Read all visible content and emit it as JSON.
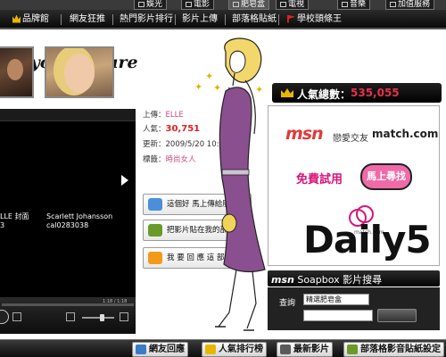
{
  "top_tabs": [
    {
      "label": "娛光"
    },
    {
      "label": "電影"
    },
    {
      "label": "肥皂盒"
    },
    {
      "label": "電視"
    },
    {
      "label": "音樂"
    },
    {
      "label": "加值服務"
    }
  ],
  "nav": {
    "items": [
      {
        "label": "品牌館"
      },
      {
        "label": "網友狂推"
      },
      {
        "label": "熱門影片排行"
      },
      {
        "label": "影片上傳"
      },
      {
        "label": "部落格貼紙"
      },
      {
        "label": "學校頭條王"
      }
    ]
  },
  "tagline": "ng your future",
  "player": {
    "thumbs": [
      {
        "caption1": "LLE 封面",
        "caption2": "3"
      },
      {
        "caption1": "Scarlett Johansson",
        "caption2": "cal0283038"
      }
    ],
    "time": "1:18 / 1:18"
  },
  "info": {
    "uploader_label": "上傳：",
    "uploader": "ELLE",
    "popularity_label": "人氣：",
    "popularity": "30,751",
    "updated_label": "更新：",
    "updated": "2009/5/20 10:49",
    "tags_label": "標籤：",
    "tags": "時尚女人"
  },
  "actions": {
    "share": "這個好 馬上傳給朋友看",
    "blog": "把影片貼在我的部落格",
    "reply": "我 要 回 應 這 部 影 片"
  },
  "panel": {
    "title": "人氣總數：",
    "count": "535,055"
  },
  "ad": {
    "msn_logo": "msn",
    "msn_text": "戀愛交友",
    "match": "match.com",
    "free_trial": "免費試用",
    "find_btn": "馬上尋找",
    "daily5_sub": "match.com",
    "daily5": "Daily5"
  },
  "soapbox": {
    "msn": "msn",
    "title_brand": "Soapbox",
    "title_rest": "影片搜尋",
    "search_label": "查詢",
    "select_value": "精選肥皂盒",
    "input_value": ""
  },
  "bottom": {
    "buttons": [
      {
        "label": "網友回應"
      },
      {
        "label": "人氣排行榜"
      },
      {
        "label": "最新影片"
      },
      {
        "label": "部落格影音貼紙設定"
      }
    ]
  },
  "colors": {
    "accent_pink": "#f06aa8",
    "count_red": "#e7304a",
    "bar_black": "#0d0d0d",
    "gold": "#e8b600"
  }
}
